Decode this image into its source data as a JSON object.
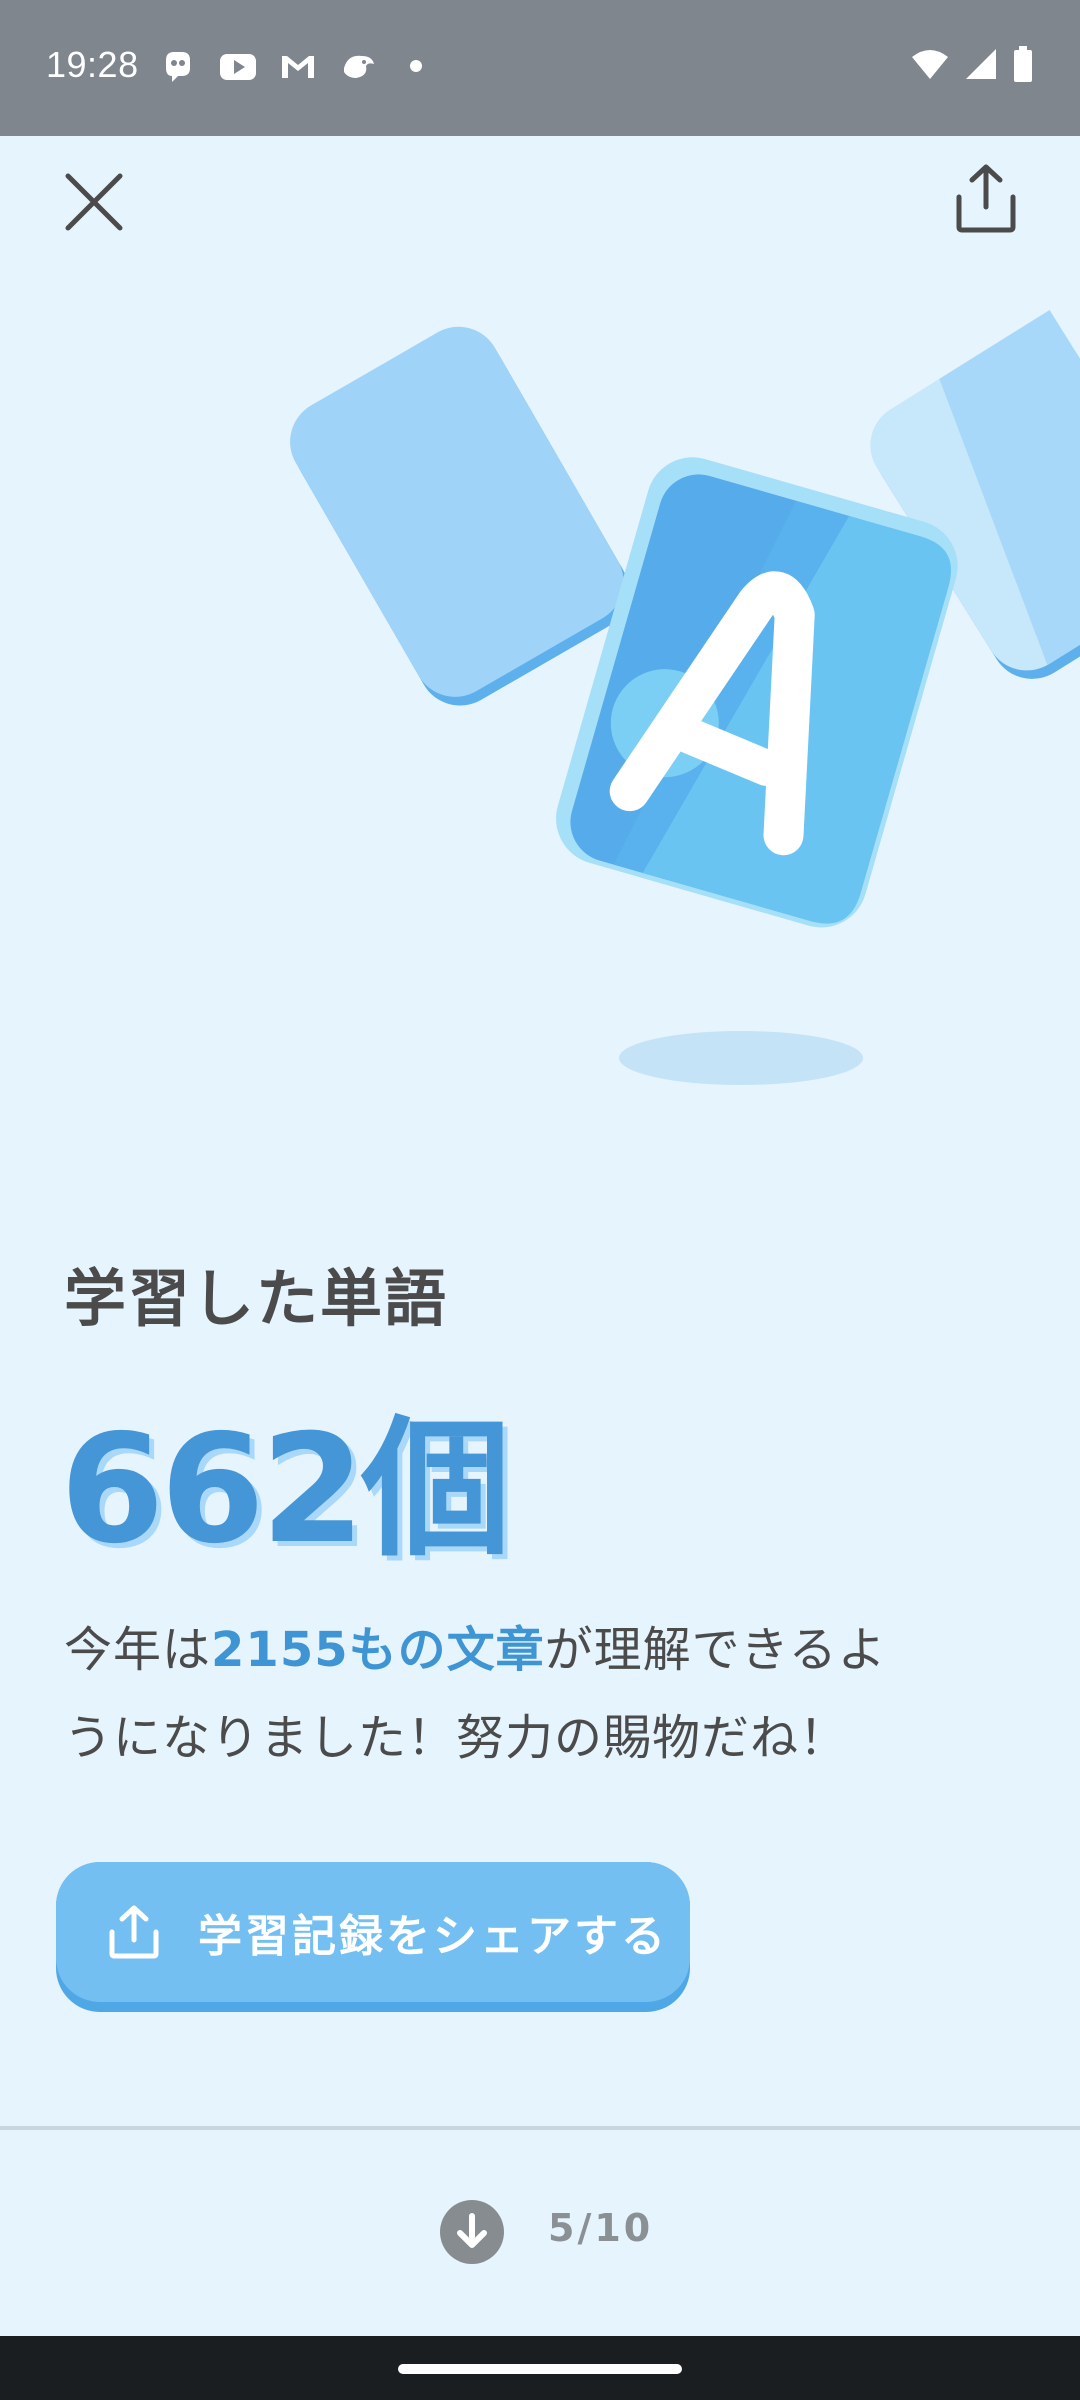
{
  "status_bar": {
    "time": "19:28",
    "notification_icons": [
      "duolingo-icon",
      "youtube-icon",
      "gmail-icon",
      "bird-icon"
    ],
    "system_icons": [
      "wifi-icon",
      "signal-icon",
      "battery-icon"
    ]
  },
  "header": {
    "close_icon": "close-icon",
    "share_icon": "share-icon"
  },
  "illustration": {
    "card_letter": "A"
  },
  "stat": {
    "title": "学習した単語",
    "count": "662個",
    "desc_prefix": "今年は",
    "desc_highlight": "2155もの文章",
    "desc_suffix": "が理解できるようになりました！努力の賜物だね！"
  },
  "share_button": {
    "label": "学習記録をシェアする",
    "icon": "share-icon"
  },
  "footer": {
    "next_icon": "arrow-down-icon",
    "page_indicator": "5/10"
  },
  "colors": {
    "background": "#e5f4fd",
    "accent": "#4596d6",
    "button": "#74bff2",
    "status_bar": "#7f868e"
  }
}
